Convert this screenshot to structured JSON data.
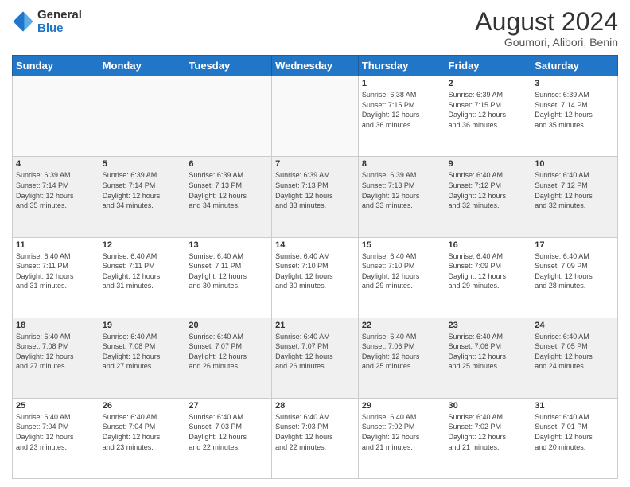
{
  "logo": {
    "line1": "General",
    "line2": "Blue"
  },
  "title": "August 2024",
  "subtitle": "Goumori, Alibori, Benin",
  "days_header": [
    "Sunday",
    "Monday",
    "Tuesday",
    "Wednesday",
    "Thursday",
    "Friday",
    "Saturday"
  ],
  "weeks": [
    [
      {
        "day": "",
        "info": "",
        "empty": true
      },
      {
        "day": "",
        "info": "",
        "empty": true
      },
      {
        "day": "",
        "info": "",
        "empty": true
      },
      {
        "day": "",
        "info": "",
        "empty": true
      },
      {
        "day": "1",
        "info": "Sunrise: 6:38 AM\nSunset: 7:15 PM\nDaylight: 12 hours\nand 36 minutes."
      },
      {
        "day": "2",
        "info": "Sunrise: 6:39 AM\nSunset: 7:15 PM\nDaylight: 12 hours\nand 36 minutes."
      },
      {
        "day": "3",
        "info": "Sunrise: 6:39 AM\nSunset: 7:14 PM\nDaylight: 12 hours\nand 35 minutes."
      }
    ],
    [
      {
        "day": "4",
        "info": "Sunrise: 6:39 AM\nSunset: 7:14 PM\nDaylight: 12 hours\nand 35 minutes."
      },
      {
        "day": "5",
        "info": "Sunrise: 6:39 AM\nSunset: 7:14 PM\nDaylight: 12 hours\nand 34 minutes."
      },
      {
        "day": "6",
        "info": "Sunrise: 6:39 AM\nSunset: 7:13 PM\nDaylight: 12 hours\nand 34 minutes."
      },
      {
        "day": "7",
        "info": "Sunrise: 6:39 AM\nSunset: 7:13 PM\nDaylight: 12 hours\nand 33 minutes."
      },
      {
        "day": "8",
        "info": "Sunrise: 6:39 AM\nSunset: 7:13 PM\nDaylight: 12 hours\nand 33 minutes."
      },
      {
        "day": "9",
        "info": "Sunrise: 6:40 AM\nSunset: 7:12 PM\nDaylight: 12 hours\nand 32 minutes."
      },
      {
        "day": "10",
        "info": "Sunrise: 6:40 AM\nSunset: 7:12 PM\nDaylight: 12 hours\nand 32 minutes."
      }
    ],
    [
      {
        "day": "11",
        "info": "Sunrise: 6:40 AM\nSunset: 7:11 PM\nDaylight: 12 hours\nand 31 minutes."
      },
      {
        "day": "12",
        "info": "Sunrise: 6:40 AM\nSunset: 7:11 PM\nDaylight: 12 hours\nand 31 minutes."
      },
      {
        "day": "13",
        "info": "Sunrise: 6:40 AM\nSunset: 7:11 PM\nDaylight: 12 hours\nand 30 minutes."
      },
      {
        "day": "14",
        "info": "Sunrise: 6:40 AM\nSunset: 7:10 PM\nDaylight: 12 hours\nand 30 minutes."
      },
      {
        "day": "15",
        "info": "Sunrise: 6:40 AM\nSunset: 7:10 PM\nDaylight: 12 hours\nand 29 minutes."
      },
      {
        "day": "16",
        "info": "Sunrise: 6:40 AM\nSunset: 7:09 PM\nDaylight: 12 hours\nand 29 minutes."
      },
      {
        "day": "17",
        "info": "Sunrise: 6:40 AM\nSunset: 7:09 PM\nDaylight: 12 hours\nand 28 minutes."
      }
    ],
    [
      {
        "day": "18",
        "info": "Sunrise: 6:40 AM\nSunset: 7:08 PM\nDaylight: 12 hours\nand 27 minutes."
      },
      {
        "day": "19",
        "info": "Sunrise: 6:40 AM\nSunset: 7:08 PM\nDaylight: 12 hours\nand 27 minutes."
      },
      {
        "day": "20",
        "info": "Sunrise: 6:40 AM\nSunset: 7:07 PM\nDaylight: 12 hours\nand 26 minutes."
      },
      {
        "day": "21",
        "info": "Sunrise: 6:40 AM\nSunset: 7:07 PM\nDaylight: 12 hours\nand 26 minutes."
      },
      {
        "day": "22",
        "info": "Sunrise: 6:40 AM\nSunset: 7:06 PM\nDaylight: 12 hours\nand 25 minutes."
      },
      {
        "day": "23",
        "info": "Sunrise: 6:40 AM\nSunset: 7:06 PM\nDaylight: 12 hours\nand 25 minutes."
      },
      {
        "day": "24",
        "info": "Sunrise: 6:40 AM\nSunset: 7:05 PM\nDaylight: 12 hours\nand 24 minutes."
      }
    ],
    [
      {
        "day": "25",
        "info": "Sunrise: 6:40 AM\nSunset: 7:04 PM\nDaylight: 12 hours\nand 23 minutes."
      },
      {
        "day": "26",
        "info": "Sunrise: 6:40 AM\nSunset: 7:04 PM\nDaylight: 12 hours\nand 23 minutes."
      },
      {
        "day": "27",
        "info": "Sunrise: 6:40 AM\nSunset: 7:03 PM\nDaylight: 12 hours\nand 22 minutes."
      },
      {
        "day": "28",
        "info": "Sunrise: 6:40 AM\nSunset: 7:03 PM\nDaylight: 12 hours\nand 22 minutes."
      },
      {
        "day": "29",
        "info": "Sunrise: 6:40 AM\nSunset: 7:02 PM\nDaylight: 12 hours\nand 21 minutes."
      },
      {
        "day": "30",
        "info": "Sunrise: 6:40 AM\nSunset: 7:02 PM\nDaylight: 12 hours\nand 21 minutes."
      },
      {
        "day": "31",
        "info": "Sunrise: 6:40 AM\nSunset: 7:01 PM\nDaylight: 12 hours\nand 20 minutes."
      }
    ]
  ]
}
